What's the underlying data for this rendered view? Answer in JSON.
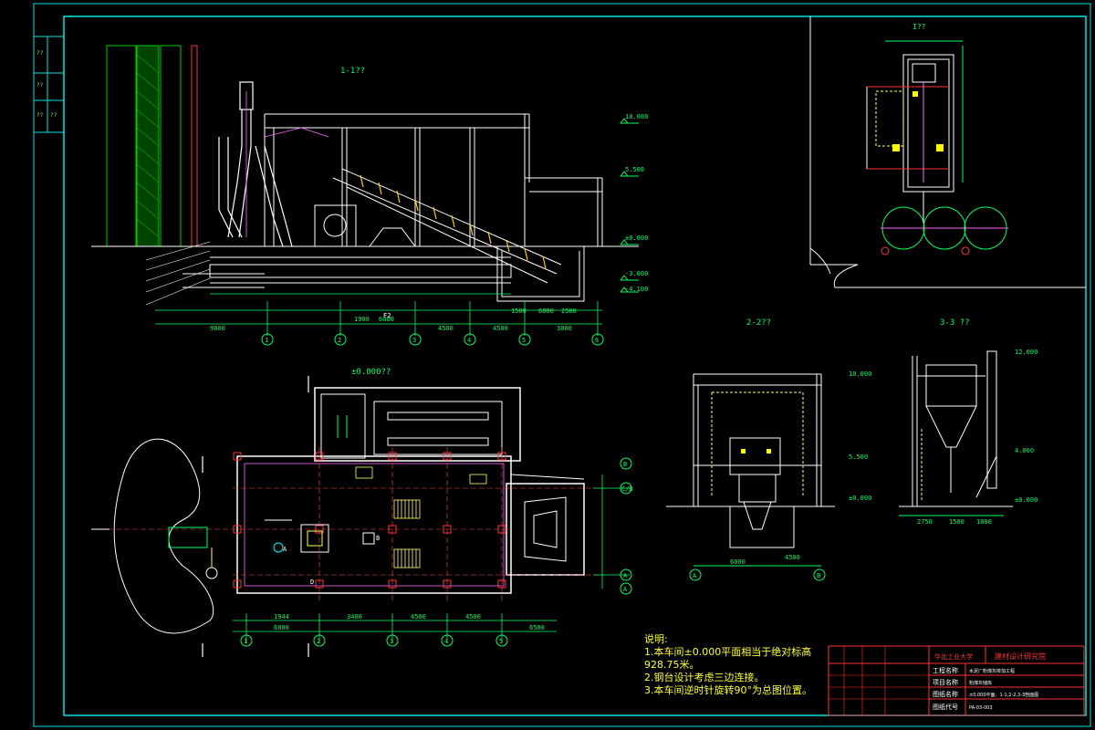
{
  "drawing": {
    "views": {
      "section_1_1": "1-1??",
      "section_2_2": "2-2??",
      "section_3_3": "3-3 ??",
      "plan": "±0.000??",
      "detail": "I??"
    },
    "axis_labels_bottom": [
      "1",
      "2",
      "3",
      "4",
      "5",
      "6"
    ],
    "axis_labels_plan_bottom": [
      "1",
      "2",
      "3",
      "4",
      "5"
    ],
    "axis_labels_plan_right": [
      "B",
      "C/B",
      "A",
      "A"
    ],
    "axis_labels_section2": [
      "A",
      "B"
    ],
    "elevations": [
      "10.000",
      "5.500",
      "±0.000",
      "-3.000",
      "-4.100",
      "10.000",
      "5.500",
      "±0.000",
      "12.000",
      "4.000",
      "±0.000"
    ],
    "dimensions_1_1": [
      "9000",
      "1900",
      "6000",
      "4500",
      "4500",
      "3000",
      "6000",
      "1500",
      "2500"
    ],
    "dimensions_plan": [
      "1944",
      "3400",
      "4500",
      "4500",
      "6500",
      "6000"
    ],
    "dimensions_2_2": [
      "6000",
      "4500"
    ],
    "dimensions_3_3": [
      "2750",
      "1500",
      "1000"
    ],
    "plan_labels": [
      "A",
      "B",
      "D",
      "F2"
    ],
    "left_strip_labels": [
      "??",
      "??",
      "??",
      "??"
    ]
  },
  "notes": {
    "title": "说明:",
    "items": [
      "1.本车间±0.000平面相当于绝对标高",
      "928.75米。",
      "2.钢台设计考虑三边连接。",
      "3.本车间逆时针旋转90°为总图位置。"
    ]
  },
  "title_block": {
    "org": "华北工业大学",
    "dept": "建材设计研究院",
    "rows": [
      "工程名称",
      "项目名称",
      "图纸名称",
      "图纸代号"
    ],
    "values": [
      "水泥厂粉煤灰掺加工程",
      "粉煤灰储库",
      "±0.000平面、1-1,2-2,3-3剖面图",
      "PA-03-003"
    ]
  }
}
